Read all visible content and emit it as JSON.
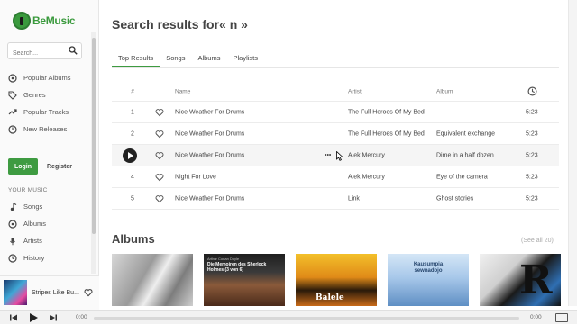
{
  "app": {
    "name": "BeMusic"
  },
  "search": {
    "placeholder": "Search..."
  },
  "sidebar": {
    "nav": [
      {
        "label": "Popular Albums",
        "icon": "disc-icon"
      },
      {
        "label": "Genres",
        "icon": "tag-icon"
      },
      {
        "label": "Popular Tracks",
        "icon": "trending-icon"
      },
      {
        "label": "New Releases",
        "icon": "clock-icon"
      }
    ],
    "login_label": "Login",
    "register_label": "Register",
    "your_music_label": "YOUR MUSIC",
    "your_music": [
      {
        "label": "Songs",
        "icon": "note-icon"
      },
      {
        "label": "Albums",
        "icon": "disc-icon"
      },
      {
        "label": "Artists",
        "icon": "mic-icon"
      },
      {
        "label": "History",
        "icon": "history-icon"
      }
    ]
  },
  "now_playing": {
    "title": "Stripes Like Bu..."
  },
  "main": {
    "title": "Search results for« n »",
    "tabs": [
      "Top Results",
      "Songs",
      "Albums",
      "Playlists"
    ],
    "active_tab": 0,
    "columns": {
      "num": "#",
      "name": "Name",
      "artist": "Artist",
      "album": "Album"
    },
    "tracks": [
      {
        "num": "1",
        "name": "Nice Weather For Drums",
        "artist": "The Full Heroes Of My Bed",
        "album": "",
        "duration": "5:23"
      },
      {
        "num": "2",
        "name": "Nice Weather For Drums",
        "artist": "The Full Heroes Of My Bed",
        "album": "Equivalent exchange",
        "duration": "5:23"
      },
      {
        "num": "3",
        "name": "Nice Weather For Drums",
        "artist": "Alek Mercury",
        "album": "Dime in a half dozen",
        "duration": "5:23"
      },
      {
        "num": "4",
        "name": "Night For Love",
        "artist": "Alek Mercury",
        "album": "Eye of the camera",
        "duration": "5:23"
      },
      {
        "num": "5",
        "name": "Nice Weather For Drums",
        "artist": "Link",
        "album": "Ghost stories",
        "duration": "5:23"
      }
    ],
    "more_label": "•••",
    "albums_title": "Albums",
    "see_all": "(See all 20)",
    "album_covers": [
      {
        "author": "",
        "text": ""
      },
      {
        "author": "Arthur Conan Doyle",
        "text": "Die Memoiren des Sherlock Holmes (3 von 6)"
      },
      {
        "author": "",
        "text": "Balele"
      },
      {
        "author": "",
        "text": "Kausumpia sewnadojo"
      },
      {
        "author": "",
        "text": "R"
      }
    ]
  },
  "player": {
    "time_current": "0:00",
    "time_total": "0:00",
    "progress": 0.0
  }
}
